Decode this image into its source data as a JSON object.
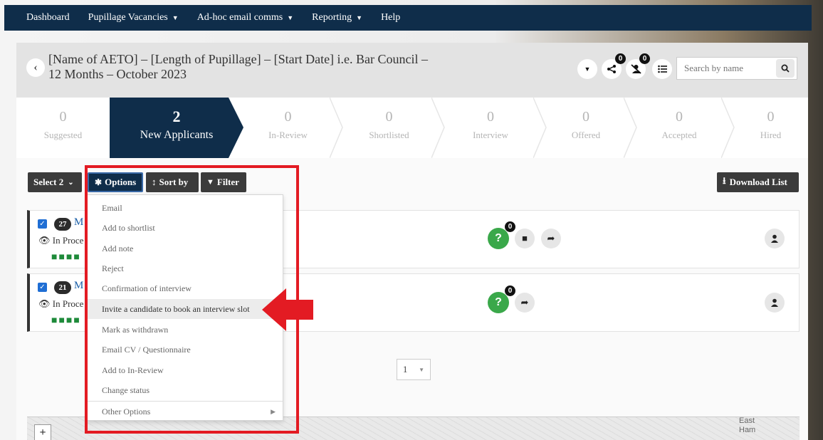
{
  "nav": {
    "items": [
      {
        "label": "Dashboard",
        "caret": false
      },
      {
        "label": "Pupillage Vacancies",
        "caret": true
      },
      {
        "label": "Ad-hoc email comms",
        "caret": true
      },
      {
        "label": "Reporting",
        "caret": true
      },
      {
        "label": "Help",
        "caret": false
      }
    ]
  },
  "header": {
    "title": "[Name of AETO] – [Length of Pupillage] – [Start Date] i.e. Bar Council – 12 Months – October 2023",
    "share_badge": "0",
    "user_badge": "0",
    "search_placeholder": "Search by name"
  },
  "pipeline": {
    "stages": [
      {
        "count": "0",
        "label": "Suggested"
      },
      {
        "count": "2",
        "label": "New Applicants",
        "active": true
      },
      {
        "count": "0",
        "label": "In-Review"
      },
      {
        "count": "0",
        "label": "Shortlisted"
      },
      {
        "count": "0",
        "label": "Interview"
      },
      {
        "count": "0",
        "label": "Offered"
      },
      {
        "count": "0",
        "label": "Accepted"
      },
      {
        "count": "0",
        "label": "Hired"
      }
    ]
  },
  "toolbar": {
    "select_label": "Select 2",
    "options_label": "Options",
    "sort_label": "Sort by",
    "filter_label": "Filter",
    "download_label": "Download List"
  },
  "applicants": [
    {
      "badge": "27",
      "name_fragment": "M",
      "status": "In Proce",
      "question_badge": "0"
    },
    {
      "badge": "21",
      "name_fragment": "M",
      "status": "In Proce",
      "question_badge": "0"
    }
  ],
  "options_menu": {
    "items": [
      "Email",
      "Add to shortlist",
      "Add note",
      "Reject",
      "Confirmation of interview",
      "Invite a candidate to book an interview slot",
      "Mark as withdrawn",
      "Email CV / Questionnaire",
      "Add to In-Review",
      "Change status"
    ],
    "highlighted_index": 5,
    "other_options": "Other Options"
  },
  "pagination": {
    "current": "1"
  },
  "map": {
    "zoom_in": "+",
    "label": "East Ham"
  },
  "colors": {
    "navy": "#0f2d4a",
    "annotation_red": "#e31b23",
    "success_green": "#3aa84a"
  }
}
